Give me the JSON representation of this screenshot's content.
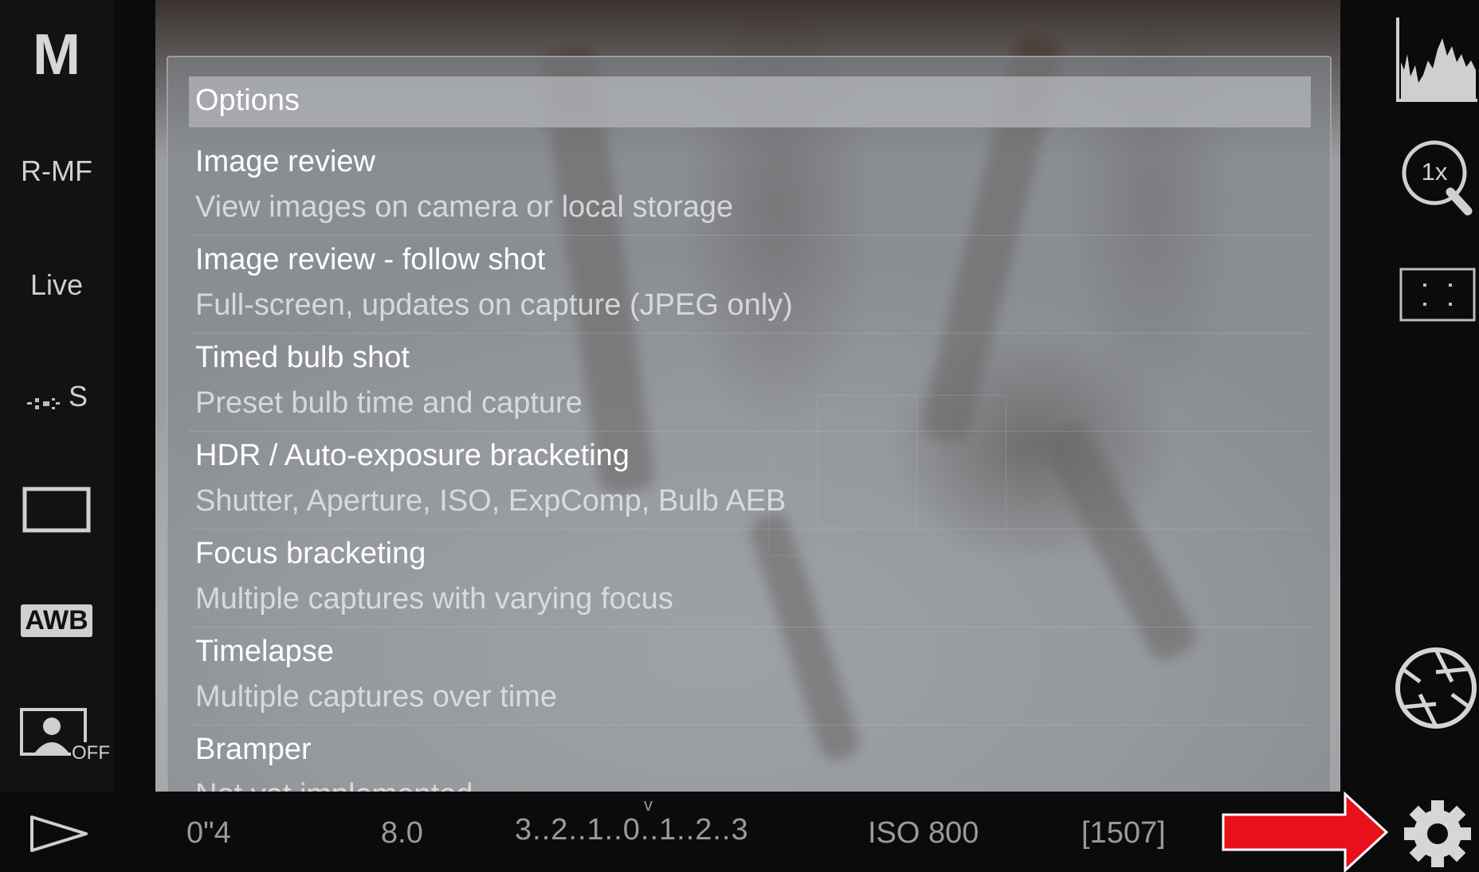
{
  "left_bar": {
    "mode": "M",
    "focus_mode": "R-MF",
    "live": "Live",
    "drive": "S",
    "drive_icon": "continuous-shooting-icon",
    "aspect_icon": "aspect-ratio-icon",
    "white_balance": "AWB",
    "face_detect_icon": "face-detect-icon",
    "face_detect_state": "OFF",
    "play_icon": "play-icon"
  },
  "options_menu": {
    "title": "Options",
    "items": [
      {
        "title": "Image review",
        "subtitle": "View images on camera or local storage"
      },
      {
        "title": "Image review - follow shot",
        "subtitle": "Full-screen, updates on capture (JPEG only)"
      },
      {
        "title": "Timed bulb shot",
        "subtitle": "Preset bulb time and capture"
      },
      {
        "title": "HDR / Auto-exposure bracketing",
        "subtitle": "Shutter, Aperture, ISO, ExpComp, Bulb AEB"
      },
      {
        "title": "Focus bracketing",
        "subtitle": "Multiple captures with varying focus"
      },
      {
        "title": "Timelapse",
        "subtitle": "Multiple captures over time"
      },
      {
        "title": "Bramper",
        "subtitle": "Not yet implemented"
      }
    ]
  },
  "status_bar": {
    "shutter": "0\"4",
    "aperture": "8.0",
    "exposure_scale": "3..2..1..0..1..2..3",
    "exposure_marker": "v",
    "iso": "ISO 800",
    "shots_remaining": "[1507]"
  },
  "right_bar": {
    "histogram_icon": "histogram-icon",
    "zoom_label": "1x",
    "zoom_icon": "zoom-magnifier-icon",
    "af_area_icon": "af-area-icon",
    "capture_icon": "shutter-aperture-icon",
    "settings_icon": "gear-icon"
  },
  "annotation": {
    "arrow_color": "#e8111b",
    "arrow_icon": "red-arrow-icon"
  }
}
